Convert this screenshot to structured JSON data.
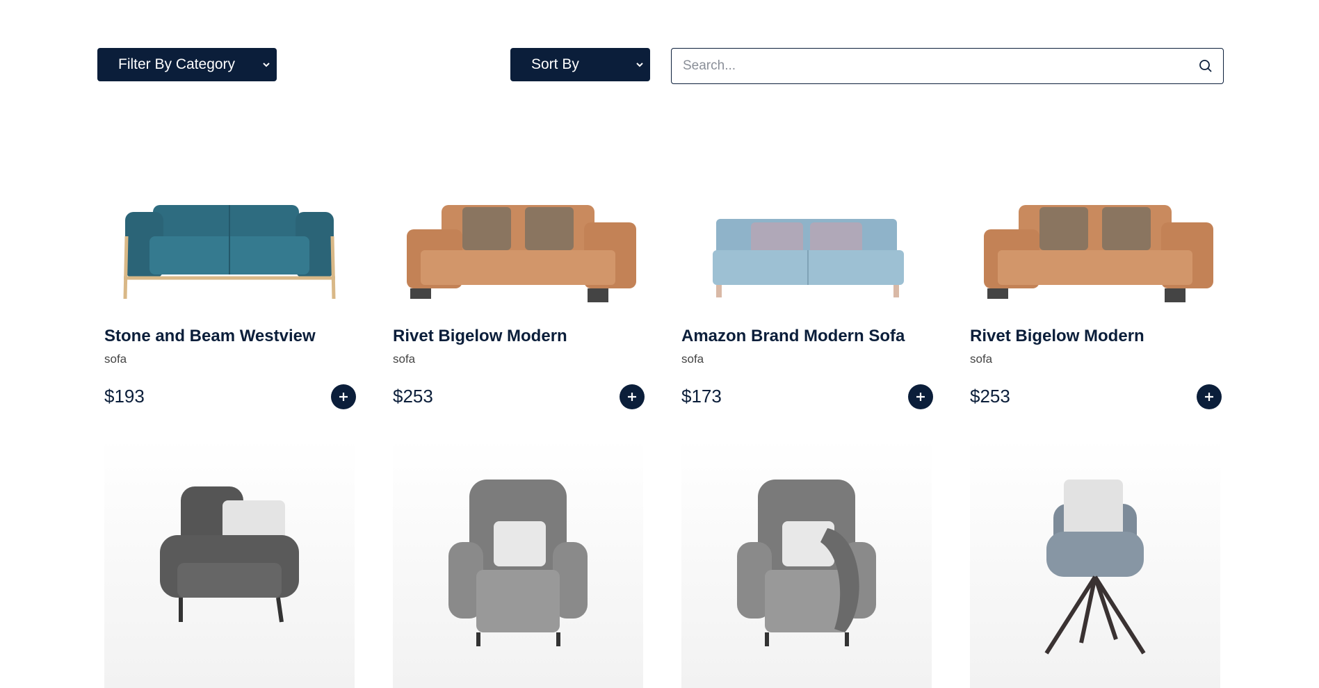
{
  "toolbar": {
    "filter_label": "Filter By Category",
    "sort_label": "Sort By",
    "search_placeholder": "Search..."
  },
  "products": [
    {
      "title": "Stone and Beam Westview",
      "category": "sofa",
      "price": "$193",
      "image": "teal-sofa"
    },
    {
      "title": "Rivet Bigelow Modern",
      "category": "sofa",
      "price": "$253",
      "image": "tan-leather-sofa"
    },
    {
      "title": "Amazon Brand Modern Sofa",
      "category": "sofa",
      "price": "$173",
      "image": "light-blue-sofa"
    },
    {
      "title": "Rivet Bigelow Modern",
      "category": "sofa",
      "price": "$253",
      "image": "tan-leather-sofa"
    }
  ],
  "armchairs": [
    {
      "image": "dark-grey-armchair"
    },
    {
      "image": "grey-wingback-armchair"
    },
    {
      "image": "grey-wingback-armchair-with-throw"
    },
    {
      "image": "grey-swivel-chair"
    }
  ],
  "colors": {
    "navy": "#0b1e3a",
    "teal": "#2e6c80",
    "tan": "#c98a5e",
    "light_blue": "#8fb3c9",
    "grey": "#6b6b6b"
  }
}
